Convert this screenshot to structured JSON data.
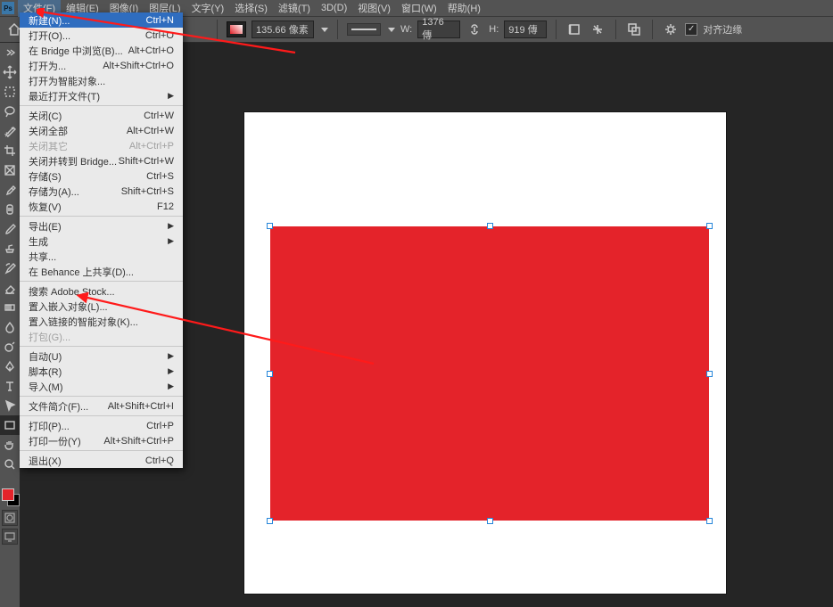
{
  "menubar": {
    "items": [
      "文件(F)",
      "编辑(E)",
      "图像(I)",
      "图层(L)",
      "文字(Y)",
      "选择(S)",
      "滤镜(T)",
      "3D(D)",
      "视图(V)",
      "窗口(W)",
      "帮助(H)"
    ]
  },
  "optbar": {
    "zoom": "135.66 像素",
    "w_label": "W:",
    "w_value": "1376 傳",
    "link_icon": "link-icon",
    "h_label": "H:",
    "h_value": "919 傳",
    "align_label": "对齐边缘"
  },
  "file_menu": [
    {
      "label": "新建(N)...",
      "shortcut": "Ctrl+N",
      "state": "highlight"
    },
    {
      "label": "打开(O)...",
      "shortcut": "Ctrl+O"
    },
    {
      "label": "在 Bridge 中浏览(B)...",
      "shortcut": "Alt+Ctrl+O"
    },
    {
      "label": "打开为...",
      "shortcut": "Alt+Shift+Ctrl+O"
    },
    {
      "label": "打开为智能对象..."
    },
    {
      "label": "最近打开文件(T)",
      "sub": true
    },
    {
      "sep": true
    },
    {
      "label": "关闭(C)",
      "shortcut": "Ctrl+W"
    },
    {
      "label": "关闭全部",
      "shortcut": "Alt+Ctrl+W"
    },
    {
      "label": "关闭其它",
      "shortcut": "Alt+Ctrl+P",
      "disabled": true
    },
    {
      "label": "关闭并转到 Bridge...",
      "shortcut": "Shift+Ctrl+W"
    },
    {
      "label": "存储(S)",
      "shortcut": "Ctrl+S"
    },
    {
      "label": "存储为(A)...",
      "shortcut": "Shift+Ctrl+S"
    },
    {
      "label": "恢复(V)",
      "shortcut": "F12"
    },
    {
      "sep": true
    },
    {
      "label": "导出(E)",
      "sub": true
    },
    {
      "label": "生成",
      "sub": true
    },
    {
      "label": "共享..."
    },
    {
      "label": "在 Behance 上共享(D)..."
    },
    {
      "sep": true
    },
    {
      "label": "搜索 Adobe Stock..."
    },
    {
      "label": "置入嵌入对象(L)..."
    },
    {
      "label": "置入链接的智能对象(K)..."
    },
    {
      "label": "打包(G)...",
      "disabled": true
    },
    {
      "sep": true
    },
    {
      "label": "自动(U)",
      "sub": true
    },
    {
      "label": "脚本(R)",
      "sub": true
    },
    {
      "label": "导入(M)",
      "sub": true
    },
    {
      "sep": true
    },
    {
      "label": "文件简介(F)...",
      "shortcut": "Alt+Shift+Ctrl+I"
    },
    {
      "sep": true
    },
    {
      "label": "打印(P)...",
      "shortcut": "Ctrl+P"
    },
    {
      "label": "打印一份(Y)",
      "shortcut": "Alt+Shift+Ctrl+P"
    },
    {
      "sep": true
    },
    {
      "label": "退出(X)",
      "shortcut": "Ctrl+Q"
    }
  ],
  "tools": [
    "move-tool",
    "artboard-tool",
    "marquee-tool",
    "lasso-tool",
    "quick-select-tool",
    "crop-tool",
    "frame-tool",
    "eyedropper-tool",
    "healing-brush-tool",
    "brush-tool",
    "clone-stamp-tool",
    "history-brush-tool",
    "eraser-tool",
    "gradient-tool",
    "blur-tool",
    "dodge-tool",
    "pen-tool",
    "type-tool",
    "path-select-tool",
    "rectangle-tool",
    "hand-tool",
    "zoom-tool"
  ],
  "chart_data": null
}
